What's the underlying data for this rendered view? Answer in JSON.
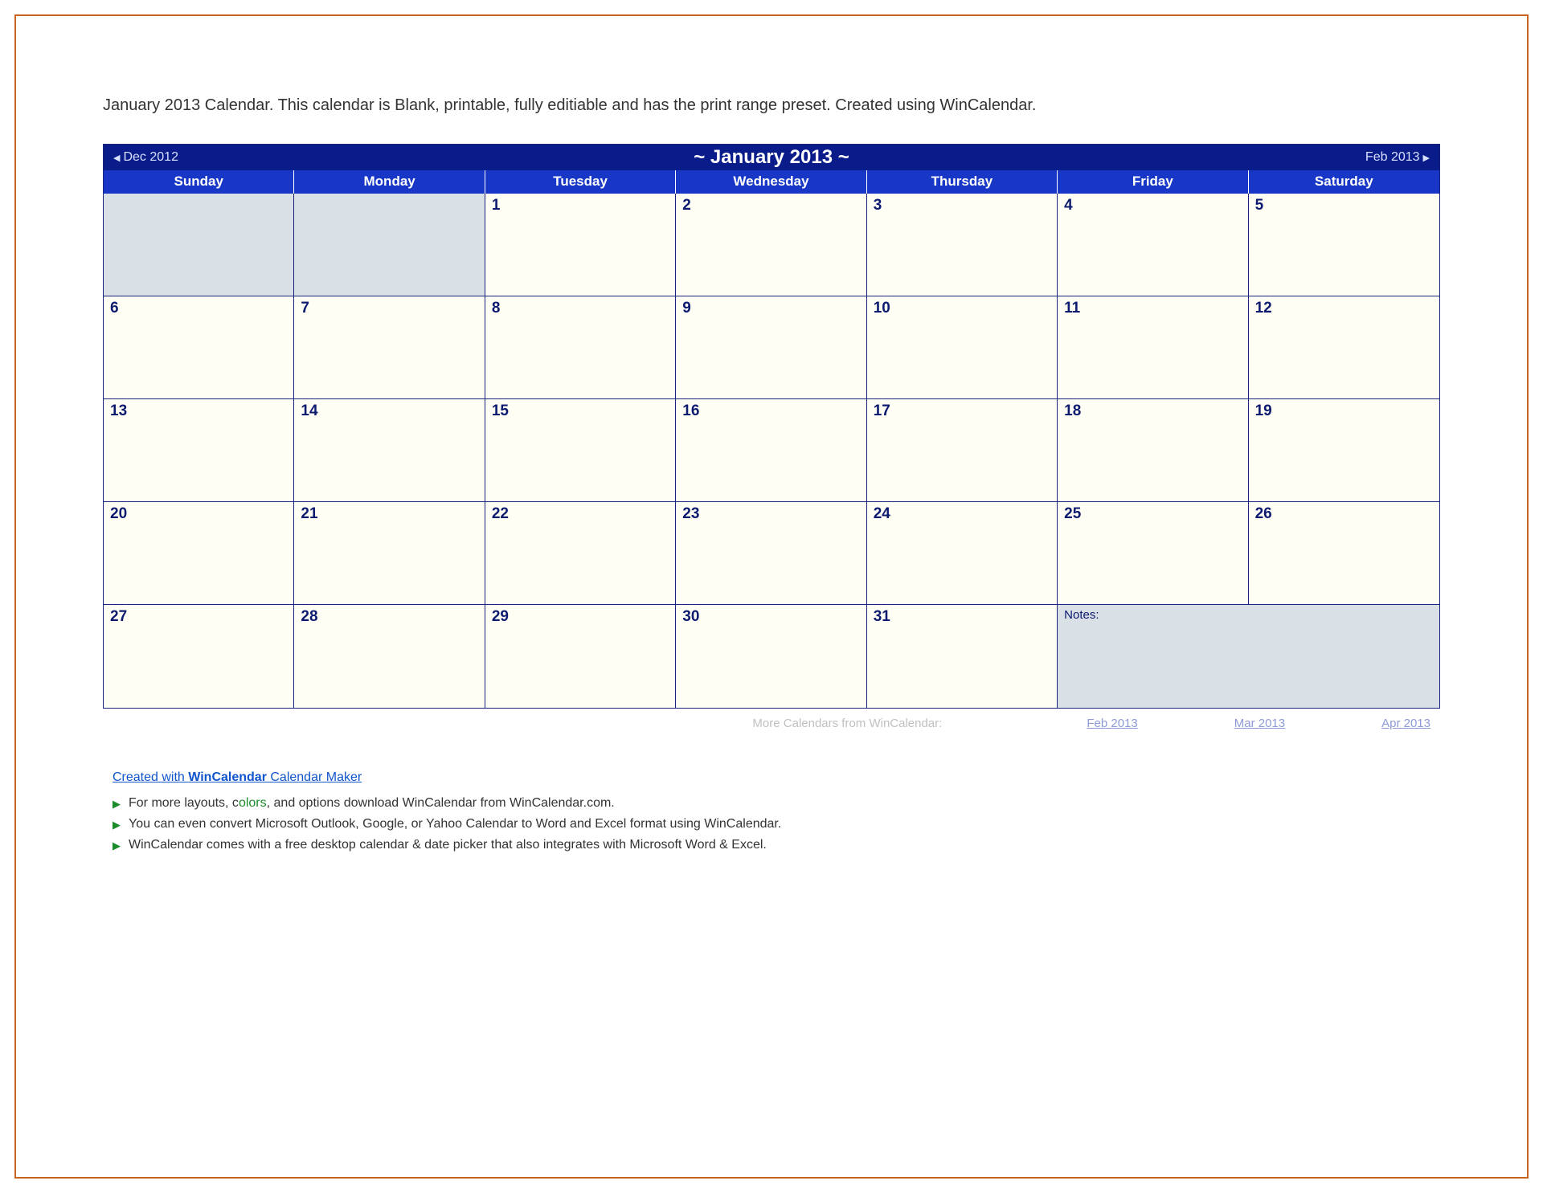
{
  "description": "January 2013 Calendar.  This calendar is Blank, printable, fully editiable and has the print range preset.  Created using WinCalendar.",
  "nav": {
    "prev": "Dec 2012",
    "next": "Feb 2013"
  },
  "title": "~  January 2013  ~",
  "dow": [
    "Sunday",
    "Monday",
    "Tuesday",
    "Wednesday",
    "Thursday",
    "Friday",
    "Saturday"
  ],
  "weeks": [
    [
      {
        "num": "",
        "prev": true
      },
      {
        "num": "",
        "prev": true
      },
      {
        "num": "1"
      },
      {
        "num": "2"
      },
      {
        "num": "3"
      },
      {
        "num": "4"
      },
      {
        "num": "5"
      }
    ],
    [
      {
        "num": "6"
      },
      {
        "num": "7"
      },
      {
        "num": "8"
      },
      {
        "num": "9"
      },
      {
        "num": "10"
      },
      {
        "num": "11"
      },
      {
        "num": "12"
      }
    ],
    [
      {
        "num": "13"
      },
      {
        "num": "14"
      },
      {
        "num": "15"
      },
      {
        "num": "16"
      },
      {
        "num": "17"
      },
      {
        "num": "18"
      },
      {
        "num": "19"
      }
    ],
    [
      {
        "num": "20"
      },
      {
        "num": "21"
      },
      {
        "num": "22"
      },
      {
        "num": "23"
      },
      {
        "num": "24"
      },
      {
        "num": "25"
      },
      {
        "num": "26"
      }
    ],
    [
      {
        "num": "27"
      },
      {
        "num": "28"
      },
      {
        "num": "29"
      },
      {
        "num": "30"
      },
      {
        "num": "31"
      }
    ]
  ],
  "notes_label": "Notes:",
  "footer": {
    "more_text": "More Calendars from WinCalendar:",
    "links": [
      "Feb 2013",
      "Mar 2013",
      "Apr 2013"
    ]
  },
  "info": {
    "created_with_prefix": "Created with ",
    "created_with_brand": "WinCalendar",
    "created_with_suffix": " Calendar Maker",
    "bullets": [
      {
        "pre": "For more layouts, c",
        "mid": "olors",
        "post": ", and options download WinCalendar from WinCalendar.com."
      },
      {
        "pre": "You can even convert Microsoft Outlook, Google, or Yahoo Calendar to Word and Excel format using WinCalendar.",
        "mid": "",
        "post": ""
      },
      {
        "pre": "WinCalendar comes with a free desktop calendar & date picker that also integrates with Microsoft Word & Excel.",
        "mid": "",
        "post": ""
      }
    ]
  }
}
